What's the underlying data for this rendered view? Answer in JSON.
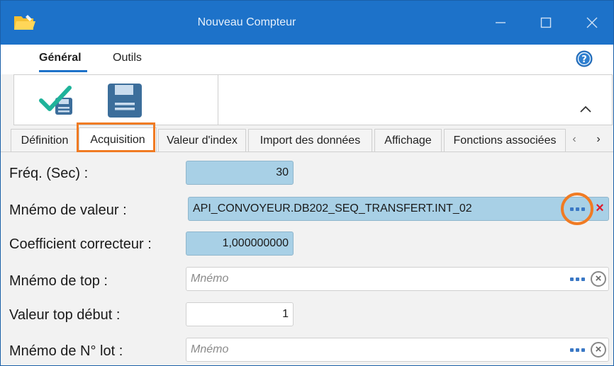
{
  "window": {
    "title": "Nouveau Compteur",
    "icon": "folder-icon",
    "controls": [
      "minimize-icon",
      "maximize-icon",
      "close-icon"
    ]
  },
  "ribbon": {
    "tabs": [
      {
        "label": "Général",
        "active": true
      },
      {
        "label": "Outils",
        "active": false
      }
    ],
    "buttons": [
      {
        "icon": "validate-check-icon"
      },
      {
        "icon": "save-floppy-icon"
      }
    ]
  },
  "form_tabs": {
    "items": [
      {
        "label": "Définition"
      },
      {
        "label": "Acquisition",
        "active": true
      },
      {
        "label": "Valeur d'index"
      },
      {
        "label": "Import des données"
      },
      {
        "label": "Affichage"
      },
      {
        "label": "Fonctions associées"
      }
    ]
  },
  "fields": {
    "freq": {
      "label": "Fréq. (Sec) :",
      "value": "30"
    },
    "mnemo_valeur": {
      "label": "Mnémo de valeur :",
      "value": "API_CONVOYEUR.DB202_SEQ_TRANSFERT.INT_02"
    },
    "coefficient": {
      "label": "Coefficient correcteur :",
      "value": "1,000000000"
    },
    "mnemo_top": {
      "label": "Mnémo de top :",
      "placeholder": "Mnémo"
    },
    "valeur_top": {
      "label": "Valeur top début :",
      "value": "1"
    },
    "mnemo_lot": {
      "label": "Mnémo de N° lot :",
      "placeholder": "Mnémo"
    }
  },
  "colors": {
    "titlebar": "#1d72c9",
    "field_blue": "#a8d0e6",
    "highlight": "#f07b23",
    "clear_red": "#e0192b"
  }
}
